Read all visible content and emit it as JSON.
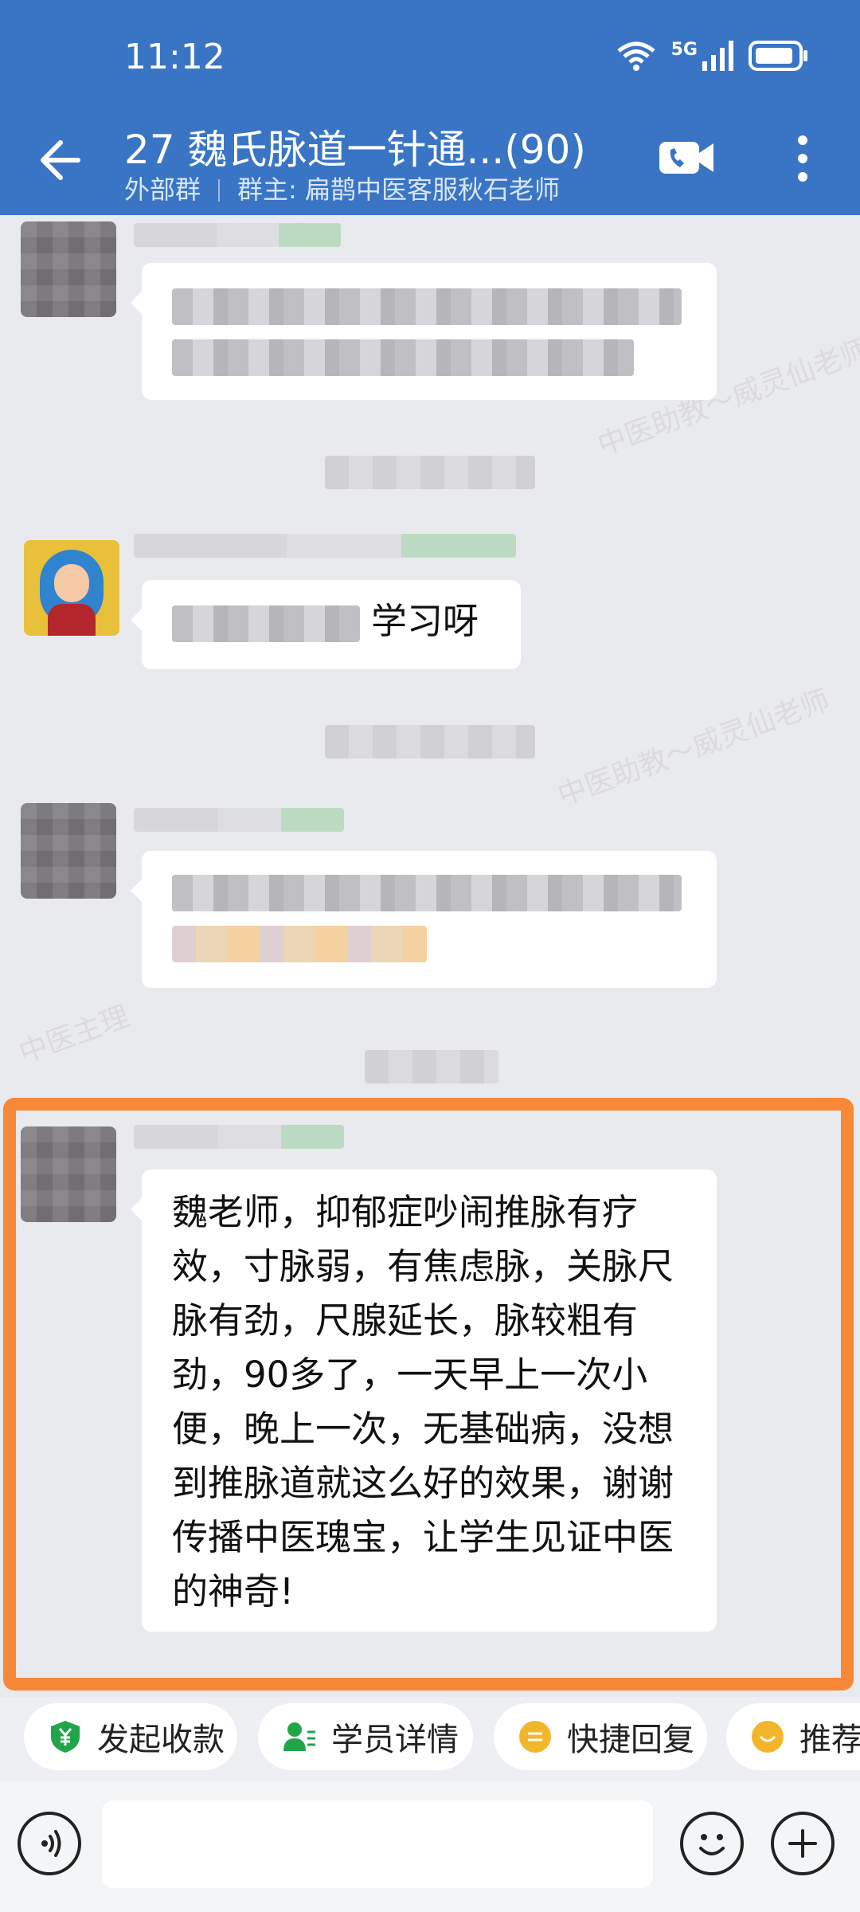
{
  "status": {
    "time": "11:12",
    "network": "5G"
  },
  "header": {
    "title": "27 魏氏脉道一针通...(90)",
    "group_type": "外部群",
    "owner": "群主: 扁鹊中医客服秋石老师"
  },
  "messages": [
    {
      "sender": "",
      "text": ""
    },
    {
      "sender": "",
      "text": "学习呀"
    },
    {
      "sender": "",
      "text": ""
    },
    {
      "sender": "",
      "text": "魏老师，抑郁症吵闹推脉有疗效，寸脉弱，有焦虑脉，关脉尺脉有劲，尺腺延长，脉较粗有劲，90多了，一天早上一次小便，晚上一次，无基础病，没想到推脉道就这么好的效果，谢谢传播中医瑰宝，让学生见证中医的神奇!"
    }
  ],
  "watermarks": [
    "中医助教～威灵仙老师",
    "中医主理"
  ],
  "quick_actions": [
    {
      "label": "发起收款",
      "icon": "yuan-shield-icon",
      "color": "#22a548"
    },
    {
      "label": "学员详情",
      "icon": "user-list-icon",
      "color": "#22a548"
    },
    {
      "label": "快捷回复",
      "icon": "quick-reply-icon",
      "color": "#f2b62b"
    },
    {
      "label": "推荐",
      "icon": "recommend-icon",
      "color": "#f2b62b"
    }
  ],
  "input": {
    "value": "",
    "placeholder": ""
  },
  "colors": {
    "header_bg": "#3a75c5",
    "highlight": "#f78837",
    "chat_bg": "#e9eaee"
  }
}
